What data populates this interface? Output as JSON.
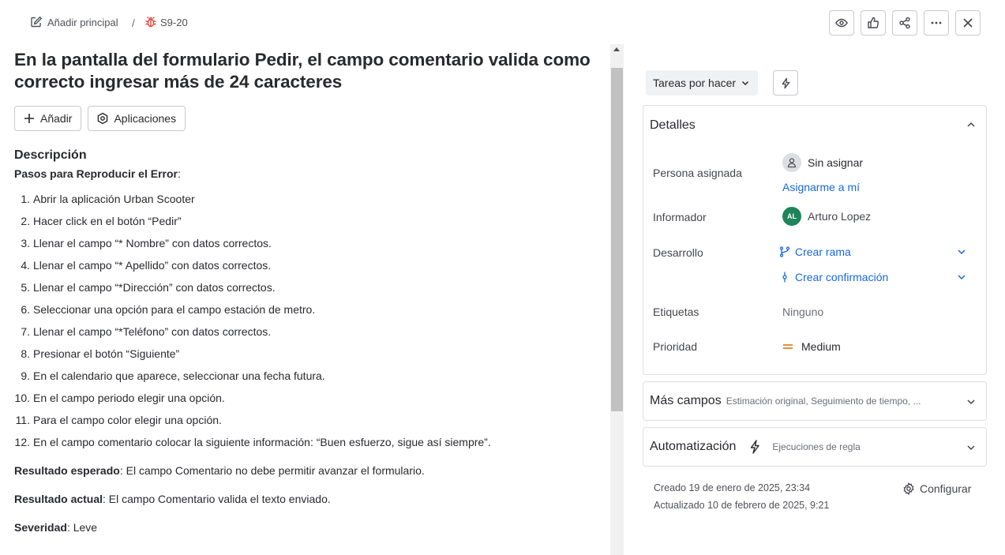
{
  "breadcrumb": {
    "add_parent_label": "Añadir principal",
    "separator": "/",
    "issue_key": "S9-20"
  },
  "top_actions": [
    {
      "icon": "eye-icon",
      "name": "watch-button"
    },
    {
      "icon": "thumbs-up-icon",
      "name": "vote-button"
    },
    {
      "icon": "share-icon",
      "name": "share-button"
    },
    {
      "icon": "more-icon",
      "name": "more-actions-button"
    },
    {
      "icon": "close-icon",
      "name": "close-button"
    }
  ],
  "issue": {
    "title": "En la pantalla del formulario Pedir, el campo comentario valida como correcto ingresar más de 24 caracteres",
    "add_button": "Añadir",
    "apps_button": "Aplicaciones"
  },
  "description": {
    "heading": "Descripción",
    "steps_label": "Pasos para Reproducir el Error",
    "steps_suffix": ":",
    "steps": [
      {
        "n": "1.",
        "text": "Abrir la aplicación Urban Scooter"
      },
      {
        "n": "2.",
        "text": "Hacer click en el botón “Pedir”"
      },
      {
        "n": "3.",
        "text": "Llenar el campo “* Nombre” con datos correctos."
      },
      {
        "n": "4.",
        "text": "Llenar el campo “* Apellido” con datos correctos."
      },
      {
        "n": "5.",
        "text": "Llenar el campo “*Dirección” con datos correctos."
      },
      {
        "n": "6.",
        "text": "Seleccionar una opción para el campo estación de metro."
      },
      {
        "n": "7.",
        "text": "Llenar el campo “*Teléfono” con datos correctos."
      },
      {
        "n": "8.",
        "text": "Presionar el botón “Siguiente”"
      },
      {
        "n": "9.",
        "text": "En el calendario que aparece, seleccionar una fecha futura."
      },
      {
        "n": "10.",
        "text": "En el campo periodo elegir una opción."
      },
      {
        "n": "11.",
        "text": "Para el campo color elegir una opción."
      },
      {
        "n": "12.",
        "text": "En el campo comentario colocar la siguiente información: “Buen esfuerzo, sigue así siempre”."
      }
    ],
    "expected_label": "Resultado esperado",
    "expected_text": ": El campo Comentario no debe permitir avanzar el formulario.",
    "actual_label": "Resultado actual",
    "actual_text": ": El campo Comentario valida el texto enviado.",
    "severity_label": "Severidad",
    "severity_text": ": Leve"
  },
  "status": {
    "label": "Tareas por hacer"
  },
  "details": {
    "heading": "Detalles",
    "assignee_label": "Persona asignada",
    "assignee_value": "Sin asignar",
    "assign_to_me": "Asignarme a mí",
    "reporter_label": "Informador",
    "reporter_initials": "AL",
    "reporter_value": "Arturo Lopez",
    "development_label": "Desarrollo",
    "create_branch": "Crear rama",
    "create_commit": "Crear confirmación",
    "labels_label": "Etiquetas",
    "labels_value": "Ninguno",
    "priority_label": "Prioridad",
    "priority_value": "Medium"
  },
  "more_fields": {
    "heading": "Más campos",
    "subtitle": "Estimación original, Seguimiento de tiempo, ..."
  },
  "automation": {
    "heading": "Automatización",
    "subtitle": "Ejecuciones de regla"
  },
  "meta": {
    "created": "Creado 19 de enero de 2025, 23:34",
    "updated": "Actualizado 10 de febrero de 2025, 9:21",
    "configure": "Configurar"
  },
  "colors": {
    "link": "#1868db",
    "bug_icon": "#e2483d",
    "priority_medium": "#e06c00",
    "avatar_reporter": "#1f845a"
  }
}
